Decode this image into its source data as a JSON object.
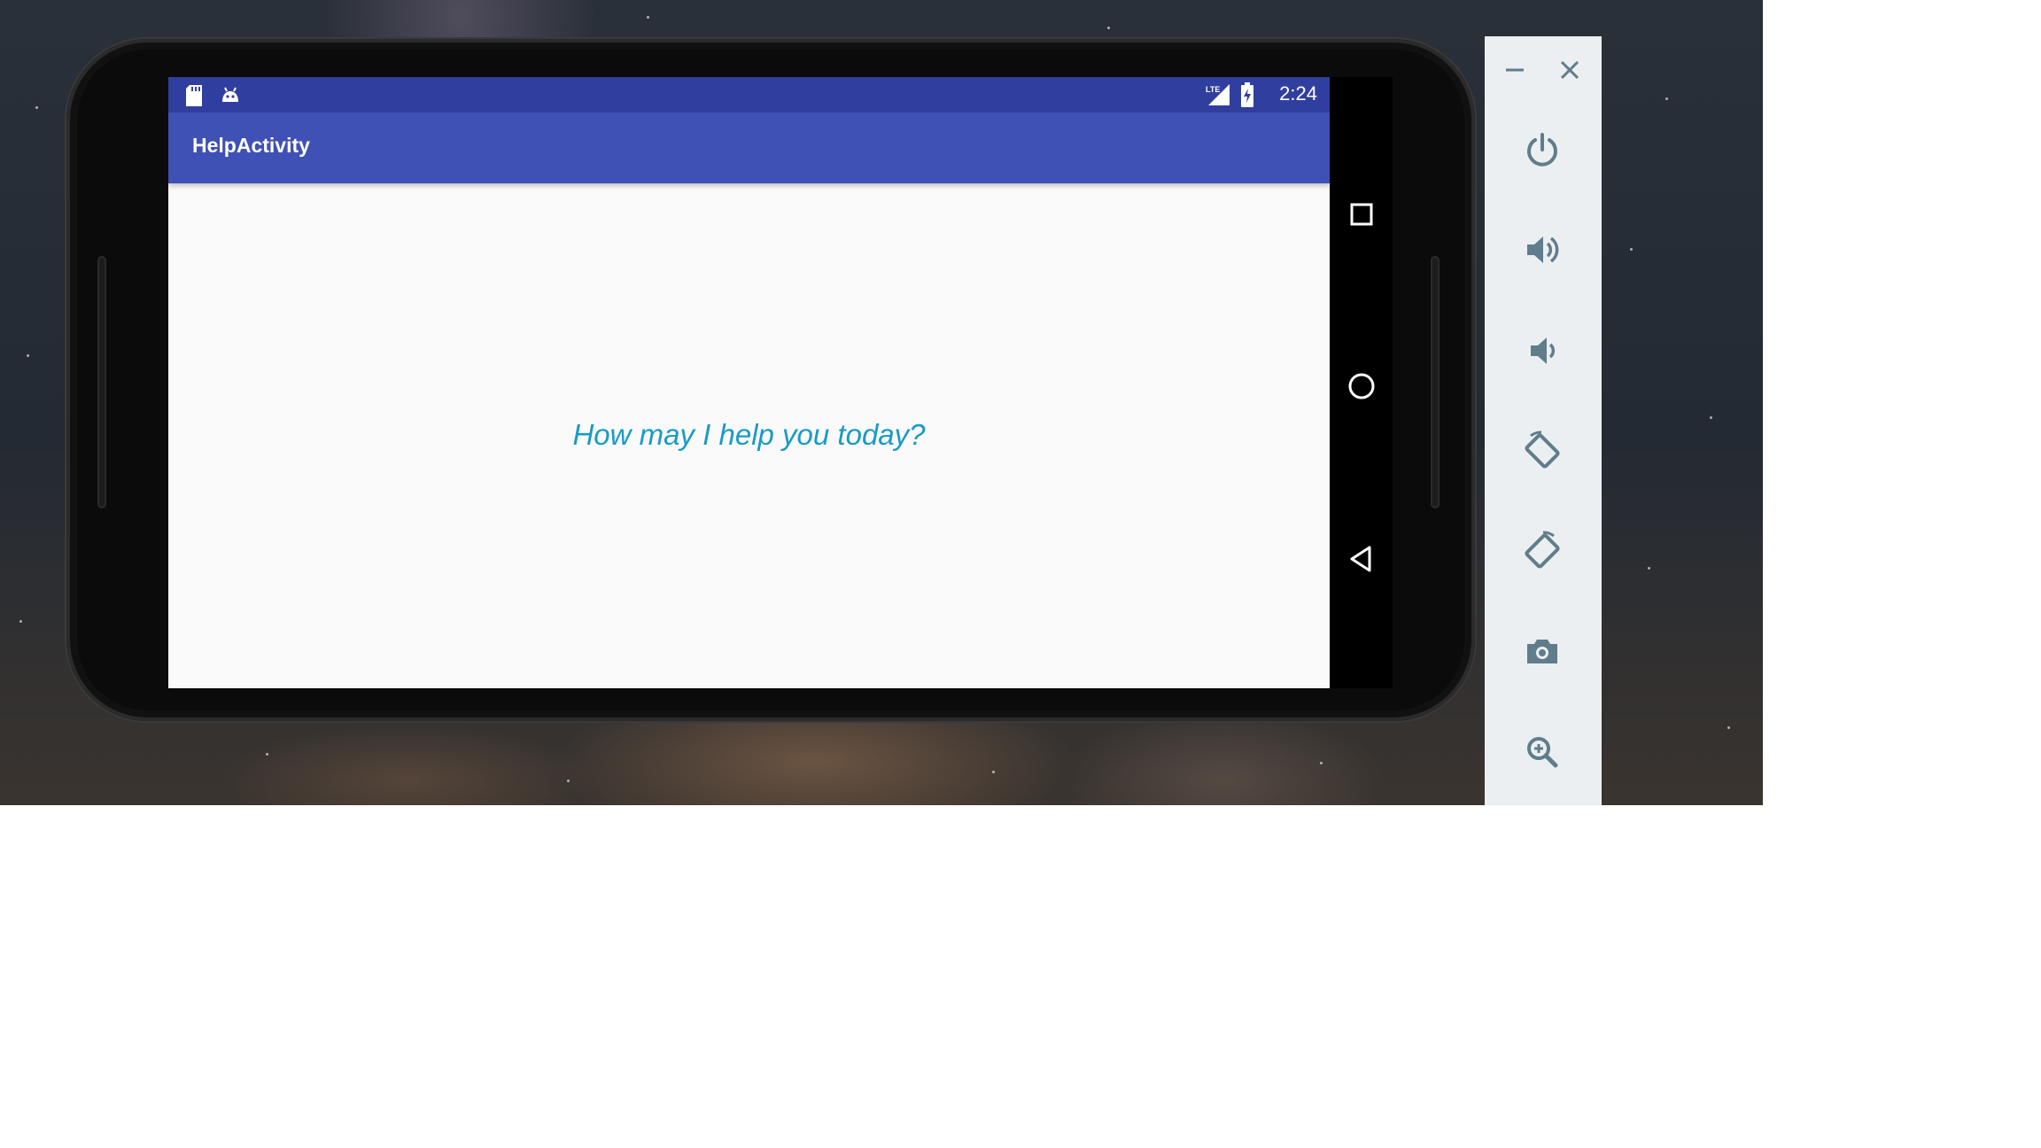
{
  "status_bar": {
    "time": "2:24",
    "left_icons": [
      "sd-card-icon",
      "android-debug-icon"
    ],
    "right_icons": [
      "lte-signal-icon",
      "battery-charging-icon"
    ]
  },
  "app": {
    "title": "HelpActivity",
    "message": "How may I help you today?"
  },
  "navigation": [
    "recents-icon",
    "home-icon",
    "back-icon"
  ],
  "emulator_toolbar": {
    "window_controls": [
      "minimize-icon",
      "close-icon"
    ],
    "buttons": [
      "power-icon",
      "volume-up-icon",
      "volume-down-icon",
      "rotate-left-icon",
      "rotate-right-icon",
      "camera-icon",
      "zoom-icon"
    ]
  },
  "colors": {
    "status_bar": "#303f9f",
    "app_bar": "#3f51b5",
    "message_text": "#1a9ac6",
    "toolbar_bg": "#eceff1",
    "toolbar_icon": "#607d8b"
  }
}
